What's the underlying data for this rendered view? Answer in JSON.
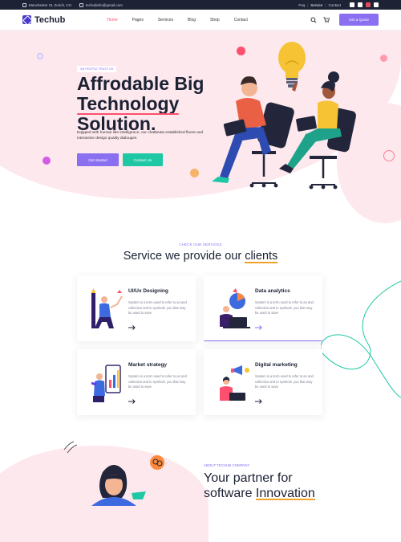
{
  "topbar": {
    "address": "Manchester St, Zurich, CH",
    "email": "techubinfo@gmail.com",
    "links": [
      "Faq",
      "Service",
      "Contact"
    ]
  },
  "nav": {
    "brand": "Techub",
    "items": [
      "Home",
      "Pages",
      "Services",
      "Blog",
      "Shop",
      "Contact"
    ],
    "active_item": "Home",
    "cta": "Get a Quote"
  },
  "hero": {
    "tag": "2M PEOPLE TRUST US",
    "title_line1": "Affrodable Big",
    "title_line2": "Technology",
    "title_line3": "Solution.",
    "lead": "Eqipped with human like intelligence, our chatbeats established fluent and interactive design quality dialouges",
    "btn_primary": "Get Started",
    "btn_secondary": "Contact Us"
  },
  "services": {
    "tag": "CHECK OUR SERVICES",
    "title_pre": "Service we provide our ",
    "title_hl": "clients",
    "cards": [
      {
        "title": "UI/Ux Designing",
        "desc": "System is a term used to refer to an and collection and to symbols. you that may be used to save"
      },
      {
        "title": "Data analytics",
        "desc": "System is a term used to refer to an and collection and to symbols. you that may be used to save"
      },
      {
        "title": "Market strategy",
        "desc": "System is a term used to refer to an and collection and to symbols. you that may be used to save"
      },
      {
        "title": "Digital marketing",
        "desc": "System is a term used to refer to an and collection and to symbols. you that may be used to save"
      }
    ]
  },
  "about": {
    "tag": "ABOUT TECHUB COMPANY",
    "title_line1": "Your partner for",
    "title_pre2": "software ",
    "title_hl": "Innovation"
  },
  "colors": {
    "accent": "#8a6ff0",
    "pink": "#ff4f6e",
    "teal": "#1ec8a5",
    "orange": "#f0a22b",
    "dark": "#1e2235"
  }
}
